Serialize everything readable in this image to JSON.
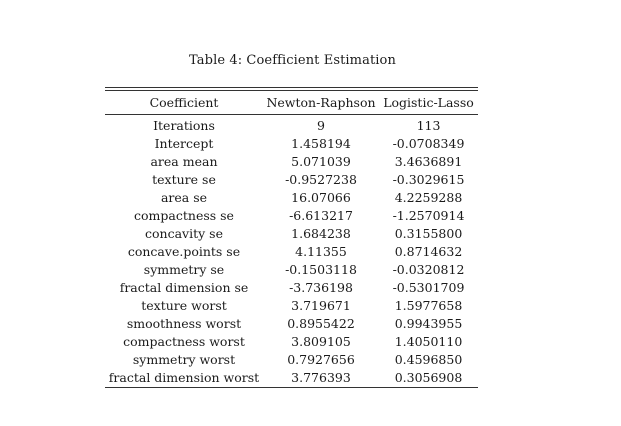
{
  "caption": "Table 4: Coefficient Estimation",
  "table": {
    "headers": [
      "Coefficient",
      "Newton-Raphson",
      "Logistic-Lasso"
    ],
    "rows": [
      [
        "Iterations",
        "9",
        "113"
      ],
      [
        "Intercept",
        "1.458194",
        "-0.0708349"
      ],
      [
        "area mean",
        "5.071039",
        "3.4636891"
      ],
      [
        "texture se",
        "-0.9527238",
        "-0.3029615"
      ],
      [
        "area se",
        "16.07066",
        "4.2259288"
      ],
      [
        "compactness se",
        "-6.613217",
        "-1.2570914"
      ],
      [
        "concavity se",
        "1.684238",
        "0.3155800"
      ],
      [
        "concave.points se",
        "4.11355",
        "0.8714632"
      ],
      [
        "symmetry se",
        "-0.1503118",
        "-0.0320812"
      ],
      [
        "fractal dimension se",
        "-3.736198",
        "-0.5301709"
      ],
      [
        "texture worst",
        "3.719671",
        "1.5977658"
      ],
      [
        "smoothness worst",
        "0.8955422",
        "0.9943955"
      ],
      [
        "compactness worst",
        "3.809105",
        "1.4050110"
      ],
      [
        "symmetry worst",
        "0.7927656",
        "0.4596850"
      ],
      [
        "fractal dimension worst",
        "3.776393",
        "0.3056908"
      ]
    ]
  }
}
